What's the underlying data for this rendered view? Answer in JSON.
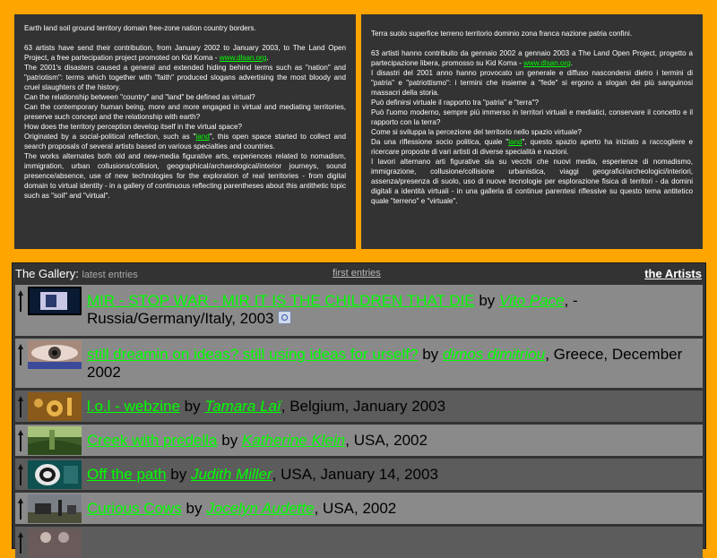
{
  "intro_en": {
    "line1": "Earth land soil ground territory domain free-zone nation country borders.",
    "p2_pre": "63 artists have send their contribution, from January 2002 to January 2003, to The Land Open Project, a free partecipation project promoted on Kid Koma - ",
    "p2_link": "www.dlsan.org",
    "p2_post": ".",
    "p3": "The 2001's disasters caused a general and extended hiding behind terms such as \"nation\" and \"patriotism\": terms which together with \"faith\" produced slogans advertising the most bloody and cruel slaughters of the history.",
    "p4": "Can the relationship between \"country\" and \"land\" be defined as virtual?",
    "p5": "Can the contemporary human being, more and more engaged in virtual and mediating territories, preserve such concept and the relationship with earth?",
    "p6": "How does the territory perception develop itself in the virtual space?",
    "p7_pre": "Originated by a social-political reflection, such as \"",
    "p7_link": "land",
    "p7_post": "\", this open space started to collect and search proposals of several artists based on various specialties and countries.",
    "p8": "The works alternates both old and new-media figurative arts, experiences related to nomadism, immigration, urban collusions/collision, geographical/archaeological/interior journeys, sound presence/absence, use of new technologies for the exploration of real territories - from digital domain to virtual identity - in a gallery of continuous reflecting parentheses about this antithetic topic such as \"soil\" and \"virtual\"."
  },
  "intro_it": {
    "line1": "Terra suolo superfice terreno territorio dominio zona franca nazione patria confini.",
    "p2_pre": "63 artisti hanno contribuito da gennaio 2002 a gennaio 2003 a The Land Open Project, progetto a partecipazione libera, promosso su Kid Koma - ",
    "p2_link": "www.dlsan.org",
    "p2_post": ".",
    "p3": "I disastri del 2001 anno hanno provocato un generale e diffuso nascondersi dietro i termini di \"patria\" e \"patriottismo\": i termini che insieme a \"fede\" si ergono a slogan dei più sanguinosi massacri della storia.",
    "p4": "Può definirsi virtuale il rapporto tra \"patria\" e \"terra\"?",
    "p5": "Può l'uomo moderno, sempre più immerso in territori virtuali e mediatici, conservare il concetto e il rapporto con la terra?",
    "p6": "Come si sviluppa la percezione del territorio nello spazio virtuale?",
    "p7_pre": "Da una riflessione socio politica, quale \"",
    "p7_link": "land",
    "p7_post": "\", questo spazio aperto ha iniziato a raccogliere e ricercare proposte di vari artisti di diverse specialità e nazioni.",
    "p8": "I lavori alternano arti figurative sia su vecchi che nuovi media, esperienze di nomadismo, immigrazione, collusione/collisione urbanistica, viaggi geografici/archeologici/interiori, assenza/presenza di suolo, uso di nuove tecnologie per esplorazione fisica di territori - da domini digitali a identità virtuali - in una galleria di continue parentesi riflessive su questo tema antitetico quale \"terreno\" e \"virtuale\"."
  },
  "gallery": {
    "title": "The Gallery:",
    "latest": "latest entries",
    "first": "first entries",
    "artists": "the Artists",
    "by": "by",
    "entries": [
      {
        "title": "MIR - STOP WAR - MIR IT IS THE CHILDREN THAT DIE",
        "artist": "Vito Pace",
        "meta": ", - Russia/Germany/Italy, 2003",
        "rss_icon": "rss-icon"
      },
      {
        "title": "still dreamin on ideas? still using ideas for urself?",
        "artist": "dimos dimitriou",
        "meta": ", Greece, December 2002"
      },
      {
        "title": "l.o.l - webzine",
        "artist": "Tamara Laï",
        "meta": ", Belgium, January 2003"
      },
      {
        "title": "Creek with predella",
        "artist": "Katherine Klein",
        "meta": ", USA, 2002"
      },
      {
        "title": "Off the path",
        "artist": "Judith Miller",
        "meta": ", USA, January 14, 2003"
      },
      {
        "title": "Curious Cows",
        "artist": "Jocelyn Audette",
        "meta": ", USA, 2002"
      }
    ]
  },
  "colors": {
    "page_bg": "#FFA500",
    "panel_bg": "#333333",
    "link": "#00FF00",
    "row_light": "#8A8A8A",
    "row_dark": "#5C5C5C"
  }
}
